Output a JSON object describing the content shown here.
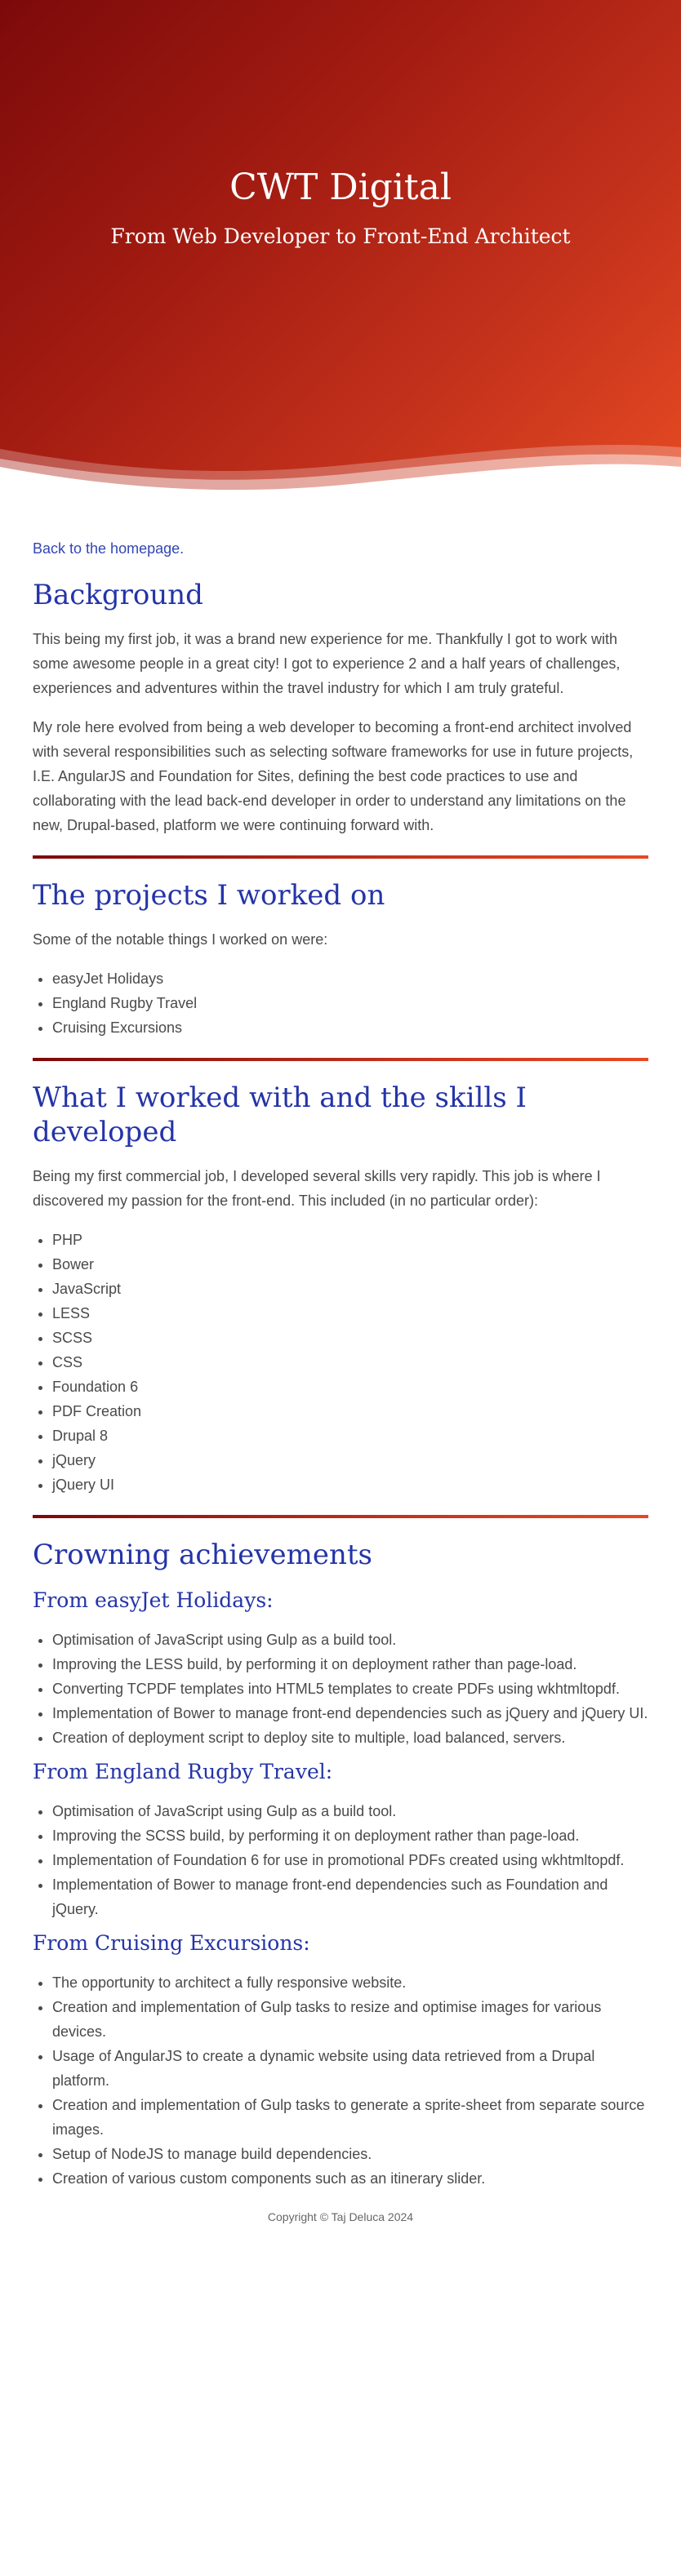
{
  "colors": {
    "hero_gradient": [
      "#7c0a0a",
      "#a51d12",
      "#c4321c",
      "#e64a22"
    ],
    "heading": "#2434a8",
    "link": "#3246b4",
    "text": "#4a4a4a",
    "background": "#ffffff"
  },
  "hero": {
    "title": "CWT Digital",
    "subtitle": "From Web Developer to Front-End Architect"
  },
  "back_link": "Back to the homepage.",
  "background_section": {
    "heading": "Background",
    "paragraphs": [
      "This being my first job, it was a brand new experience for me. Thankfully I got to work with some awesome people in a great city! I got to experience 2 and a half years of challenges, experiences and adventures within the travel industry for which I am truly grateful.",
      "My role here evolved from being a web developer to becoming a front-end architect involved with several responsibilities such as selecting software frameworks for use in future projects, I.E. AngularJS and Foundation for Sites, defining the best code practices to use and collaborating with the lead back-end developer in order to understand any limitations on the new, Drupal-based, platform we were continuing forward with."
    ]
  },
  "projects_section": {
    "heading": "The projects I worked on",
    "intro": "Some of the notable things I worked on were:",
    "items": [
      "easyJet Holidays",
      "England Rugby Travel",
      "Cruising Excursions"
    ]
  },
  "skills_section": {
    "heading": "What I worked with and the skills I developed",
    "intro": "Being my first commercial job, I developed several skills very rapidly. This job is where I discovered my passion for the front-end. This included (in no particular order):",
    "items": [
      "PHP",
      "Bower",
      "JavaScript",
      "LESS",
      "SCSS",
      "CSS",
      "Foundation 6",
      "PDF Creation",
      "Drupal 8",
      "jQuery",
      "jQuery UI"
    ]
  },
  "achievements_section": {
    "heading": "Crowning achievements",
    "groups": [
      {
        "heading": "From easyJet Holidays:",
        "items": [
          "Optimisation of JavaScript using Gulp as a build tool.",
          "Improving the LESS build, by performing it on deployment rather than page-load.",
          "Converting TCPDF templates into HTML5 templates to create PDFs using wkhtmltopdf.",
          "Implementation of Bower to manage front-end dependencies such as jQuery and jQuery UI.",
          "Creation of deployment script to deploy site to multiple, load balanced, servers."
        ]
      },
      {
        "heading": "From England Rugby Travel:",
        "items": [
          "Optimisation of JavaScript using Gulp as a build tool.",
          "Improving the SCSS build, by performing it on deployment rather than page-load.",
          "Implementation of Foundation 6 for use in promotional PDFs created using wkhtmltopdf.",
          "Implementation of Bower to manage front-end dependencies such as Foundation and jQuery."
        ]
      },
      {
        "heading": "From Cruising Excursions:",
        "items": [
          "The opportunity to architect a fully responsive website.",
          "Creation and implementation of Gulp tasks to resize and optimise images for various devices.",
          "Usage of AngularJS to create a dynamic website using data retrieved from a Drupal platform.",
          "Creation and implementation of Gulp tasks to generate a sprite-sheet from separate source images.",
          "Setup of NodeJS to manage build dependencies.",
          "Creation of various custom components such as an itinerary slider."
        ]
      }
    ]
  },
  "footer": "Copyright © Taj Deluca 2024"
}
